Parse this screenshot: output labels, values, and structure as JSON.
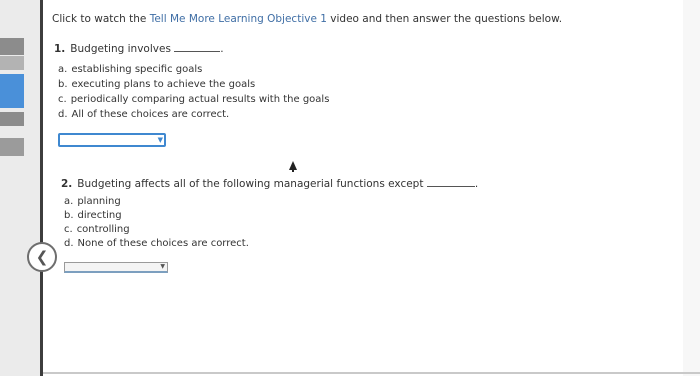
{
  "instructions": {
    "prefix": "Click to watch the ",
    "link": "Tell Me More Learning Objective 1",
    "suffix": " video and then answer the questions below."
  },
  "questions": [
    {
      "number": "1.",
      "stem": "Budgeting involves",
      "end": ".",
      "options": [
        {
          "letter": "a.",
          "text": "establishing specific goals"
        },
        {
          "letter": "b.",
          "text": "executing plans to achieve the goals"
        },
        {
          "letter": "c.",
          "text": "periodically comparing actual results with the goals"
        },
        {
          "letter": "d.",
          "text": "All of these choices are correct."
        }
      ],
      "selected": ""
    },
    {
      "number": "2.",
      "stem": "Budgeting affects all of the following managerial functions except",
      "end": ".",
      "options": [
        {
          "letter": "a.",
          "text": "planning"
        },
        {
          "letter": "b.",
          "text": "directing"
        },
        {
          "letter": "c.",
          "text": "controlling"
        },
        {
          "letter": "d.",
          "text": "None of these choices are correct."
        }
      ],
      "selected": ""
    }
  ],
  "icons": {
    "back": "chevron-left-icon",
    "dropdown": "caret-down-icon",
    "cursor": "mouse-pointer-icon"
  },
  "colors": {
    "link": "#3f6ea5",
    "focus_border": "#3f88d0",
    "sidebar_accent": "#4a90d9"
  }
}
